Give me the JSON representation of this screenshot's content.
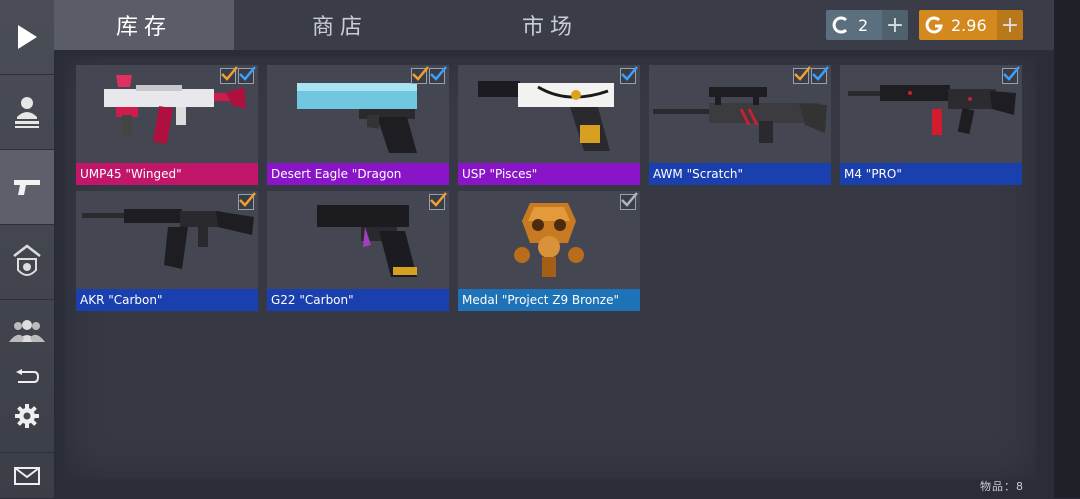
{
  "tabs": [
    {
      "label": "库存",
      "active": true
    },
    {
      "label": "商店",
      "active": false
    },
    {
      "label": "市场",
      "active": false
    }
  ],
  "currency": {
    "credits": {
      "icon": "credits-c-icon",
      "value": "2",
      "color": "#5c6f7e"
    },
    "gold": {
      "icon": "gold-g-icon",
      "value": "2.96",
      "color": "#d3891e"
    },
    "add_label": "+"
  },
  "sidebar": {
    "items": [
      "play-icon",
      "character-icon",
      "pistol-icon",
      "clan-shield-icon",
      "friends-icon",
      "back-icon",
      "settings-gear-icon",
      "mail-icon"
    ]
  },
  "inventory": {
    "items": [
      {
        "name": "UMP45 \"Winged\"",
        "color": "#c2166a",
        "checks": [
          "orange",
          "blue"
        ]
      },
      {
        "name": "Desert Eagle \"Dragon",
        "color": "#8a15c8",
        "checks": [
          "orange",
          "blue"
        ]
      },
      {
        "name": "USP \"Pisces\"",
        "color": "#8a15c8",
        "checks": [
          "blue"
        ]
      },
      {
        "name": "AWM \"Scratch\"",
        "color": "#1a3fae",
        "checks": [
          "orange",
          "blue"
        ]
      },
      {
        "name": "M4 \"PRO\"",
        "color": "#1a3fae",
        "checks": [
          "blue"
        ]
      },
      {
        "name": "AKR \"Carbon\"",
        "color": "#1a3fae",
        "checks": [
          "orange"
        ]
      },
      {
        "name": "G22 \"Carbon\"",
        "color": "#1a3fae",
        "checks": [
          "orange"
        ]
      },
      {
        "name": "Medal \"Project Z9 Bronze\"",
        "color": "#1e73b8",
        "checks": [
          "gray"
        ]
      }
    ]
  },
  "footer": {
    "items_label": "物品：8"
  }
}
